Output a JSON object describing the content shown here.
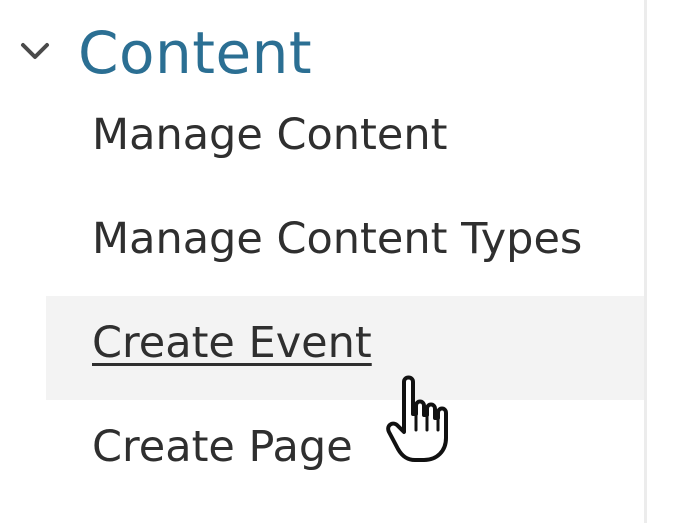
{
  "section": {
    "title": "Content",
    "expanded": true,
    "toggle_icon": "chevron-down-icon"
  },
  "menu": {
    "items": [
      {
        "label": "Manage Content",
        "hovered": false
      },
      {
        "label": "Manage Content Types",
        "hovered": false
      },
      {
        "label": "Create Event",
        "hovered": true
      },
      {
        "label": "Create Page",
        "hovered": false
      }
    ]
  },
  "cursor": {
    "icon": "pointer-hand-icon"
  },
  "colors": {
    "title": "#2b6f93",
    "text": "#2f2f2f",
    "hover_background": "#f3f3f3",
    "chevron": "#4a4a4a"
  }
}
